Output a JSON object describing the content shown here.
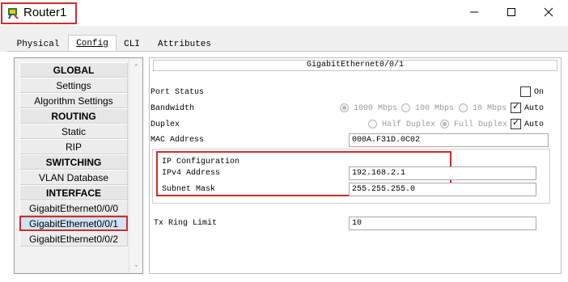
{
  "window": {
    "title": "Router1"
  },
  "tabs": [
    {
      "label": "Physical"
    },
    {
      "label": "Config"
    },
    {
      "label": "CLI"
    },
    {
      "label": "Attributes"
    }
  ],
  "nav": {
    "items": [
      {
        "label": "GLOBAL",
        "type": "header"
      },
      {
        "label": "Settings",
        "type": "item"
      },
      {
        "label": "Algorithm Settings",
        "type": "item"
      },
      {
        "label": "ROUTING",
        "type": "header"
      },
      {
        "label": "Static",
        "type": "item"
      },
      {
        "label": "RIP",
        "type": "item"
      },
      {
        "label": "SWITCHING",
        "type": "header"
      },
      {
        "label": "VLAN Database",
        "type": "item"
      },
      {
        "label": "INTERFACE",
        "type": "header"
      },
      {
        "label": "GigabitEthernet0/0/0",
        "type": "item"
      },
      {
        "label": "GigabitEthernet0/0/1",
        "type": "item",
        "selected": true
      },
      {
        "label": "GigabitEthernet0/0/2",
        "type": "item"
      }
    ]
  },
  "panel": {
    "title": "GigabitEthernet0/0/1",
    "port_status": {
      "label": "Port Status",
      "on_label": "On",
      "on_checked": false
    },
    "bandwidth": {
      "label": "Bandwidth",
      "options": [
        "1000 Mbps",
        "100 Mbps",
        "10 Mbps"
      ],
      "selected": "1000 Mbps",
      "auto_label": "Auto",
      "auto_checked": true
    },
    "duplex": {
      "label": "Duplex",
      "options": [
        "Half Duplex",
        "Full Duplex"
      ],
      "selected": "Full Duplex",
      "auto_label": "Auto",
      "auto_checked": true
    },
    "mac": {
      "label": "MAC Address",
      "value": "000A.F31D.0C02"
    },
    "ip": {
      "section_label": "IP Configuration",
      "ipv4_label": "IPv4 Address",
      "ipv4_value": "192.168.2.1",
      "mask_label": "Subnet Mask",
      "mask_value": "255.255.255.0"
    },
    "tx": {
      "label": "Tx Ring Limit",
      "value": "10"
    }
  },
  "colors": {
    "highlight": "#d62a2a",
    "selected_bg": "#cfe3f7"
  }
}
